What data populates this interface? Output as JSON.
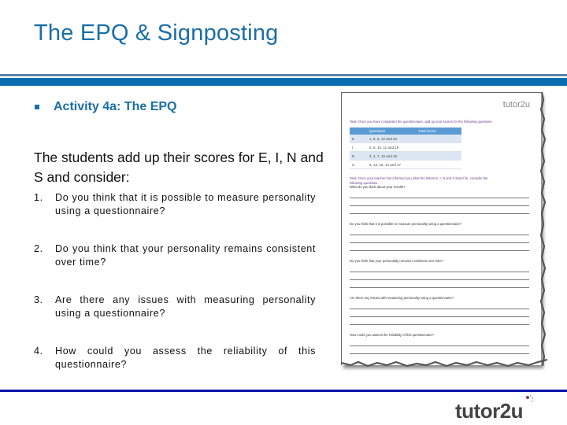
{
  "slide": {
    "title": "The EPQ & Signposting",
    "bullet_heading": "Activity 4a: The EPQ",
    "intro": "The students add up their scores for E, I, N and S and consider:",
    "questions": [
      {
        "num": "1.",
        "text": "Do you think that it is possible to measure personality using a questionnaire?"
      },
      {
        "num": "2.",
        "text": "Do you think that your personality remains consistent over time?"
      },
      {
        "num": "3.",
        "text": "Are there any issues with measuring personality using a questionnaire?"
      },
      {
        "num": "4.",
        "text": "How could you assess the reliability of this questionnaire?"
      }
    ]
  },
  "worksheet": {
    "logo": "tutor2u",
    "task1": "Task: Once you have completed the questionnaire, add up your scores for the following questions.",
    "table": {
      "headers": [
        "",
        "Questions",
        "Total Score"
      ],
      "rows": [
        [
          "E",
          "1, 8, 9, 12 and 20",
          ""
        ],
        [
          "I",
          "2, 5, 10, 11 and 19",
          ""
        ],
        [
          "N",
          "3, 4, 7, 16 and 18",
          ""
        ],
        [
          "S",
          "6, 13, 15, 14 and 17",
          ""
        ]
      ]
    },
    "task2_line1": "Task: Once your teacher has informed you what the letters E, I, N and S stand for, consider the",
    "task2_line2": "following questions.",
    "prompts": [
      "What do you think about your results?",
      "Do you think that it is possible to measure personality using a questionnaire?",
      "Do you think that your personality remains consistent over time?",
      "Are there any issues with measuring personality using a questionnaire?",
      "How could you assess the reliability of this questionnaire?"
    ]
  },
  "footer": {
    "logo": "tutor2u"
  },
  "colors": {
    "title_blue": "#1a6ea8",
    "header_bar": "#0a6db3",
    "footer_rule": "#0c10a8",
    "table_header": "#5b9bd5",
    "task_purple": "#6a3d8c"
  }
}
